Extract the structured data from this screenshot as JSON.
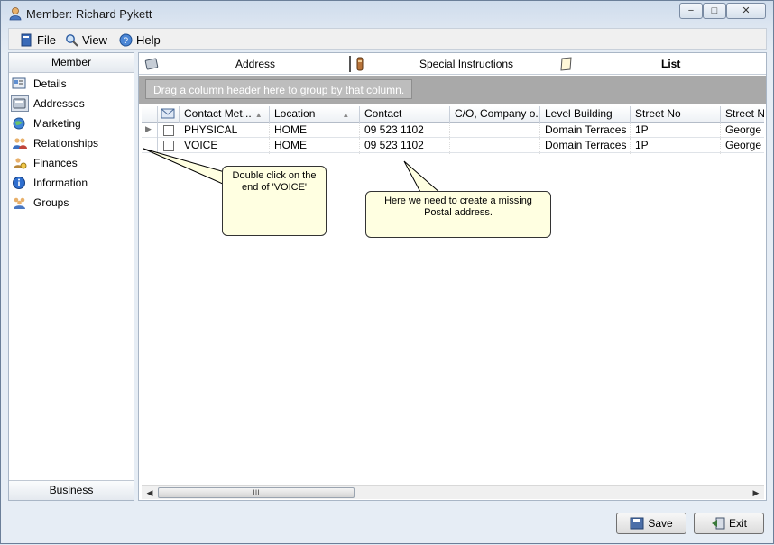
{
  "window": {
    "title": "Member: Richard Pykett",
    "controls": {
      "minimize": "−",
      "maximize": "□",
      "close": "✕"
    }
  },
  "menubar": {
    "items": [
      {
        "label": "File",
        "icon": "file-icon"
      },
      {
        "label": "View",
        "icon": "magnifier-icon"
      },
      {
        "label": "Help",
        "icon": "help-icon"
      }
    ]
  },
  "sidebar": {
    "header": "Member",
    "footer": "Business",
    "items": [
      {
        "label": "Details",
        "icon": "details-icon"
      },
      {
        "label": "Addresses",
        "icon": "addresses-icon",
        "selected": true
      },
      {
        "label": "Marketing",
        "icon": "globe-icon"
      },
      {
        "label": "Relationships",
        "icon": "people-icon"
      },
      {
        "label": "Finances",
        "icon": "money-icon"
      },
      {
        "label": "Information",
        "icon": "info-icon"
      },
      {
        "label": "Groups",
        "icon": "group-icon"
      }
    ]
  },
  "tabs": [
    {
      "label": "Address",
      "icon": "address-book-icon"
    },
    {
      "label": "Special Instructions",
      "icon": "instructions-icon"
    },
    {
      "label": "List",
      "icon": "list-icon",
      "active": true
    }
  ],
  "grid": {
    "group_hint": "Drag a column header here to group by that column.",
    "columns": [
      "Contact Met...",
      "Location",
      "Contact",
      "C/O, Company o...",
      "Level Building",
      "Street No",
      "Street Na"
    ],
    "rows": [
      [
        "PHYSICAL",
        "HOME",
        "09 523 1102",
        "",
        "Domain Terraces",
        "1P",
        "George S"
      ],
      [
        "VOICE",
        "HOME",
        "09 523 1102",
        "",
        "Domain Terraces",
        "1P",
        "George S"
      ]
    ],
    "scroll_thumb": "III"
  },
  "callouts": {
    "first": "Double click on the end of 'VOICE'",
    "second": "Here we need to create a missing Postal address."
  },
  "buttons": {
    "save": "Save",
    "exit": "Exit"
  }
}
